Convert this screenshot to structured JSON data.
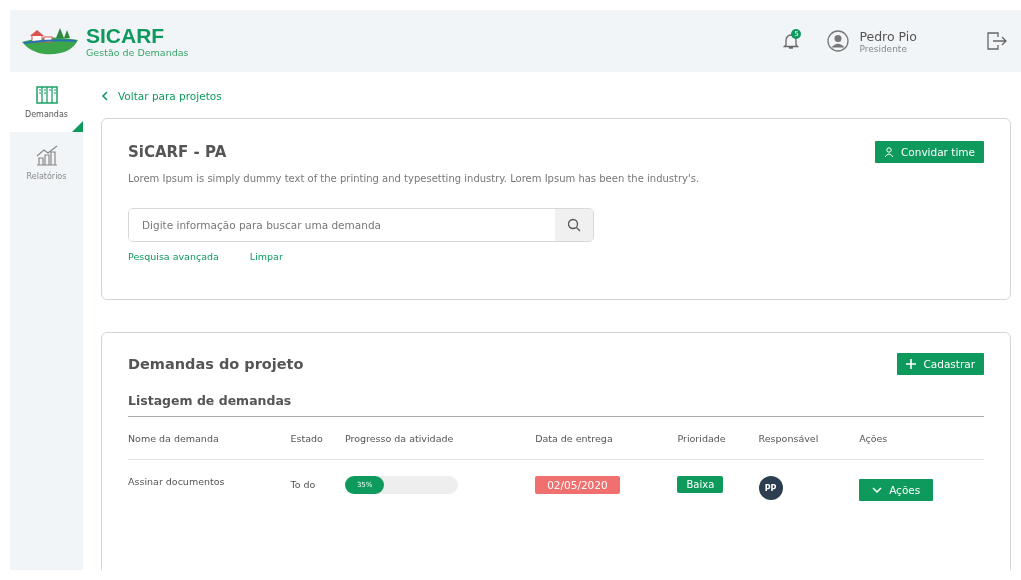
{
  "header": {
    "app_name": "SICARF",
    "subtitle": "Gestão de Demandas",
    "notification_count": "5",
    "user_name": "Pedro Pio",
    "user_role": "Presidente"
  },
  "sidebar": {
    "items": [
      {
        "label": "Demandas",
        "kind": "board",
        "selected": true
      },
      {
        "label": "Relatórios",
        "kind": "chart",
        "selected": false
      }
    ]
  },
  "back_link": "Voltar para projetos",
  "project": {
    "title": "SiCARF - PA",
    "description": "Lorem Ipsum is simply dummy text of the printing and typesetting industry. Lorem Ipsum has been the industry's.",
    "invite_button": "Convidar time",
    "search": {
      "placeholder": "Digite informação para buscar uma demanda"
    },
    "links": [
      "Pesquisa avançada",
      "Limpar"
    ]
  },
  "demands": {
    "title": "Demandas do projeto",
    "add_button": "Cadastrar",
    "subtitle": "Listagem de demandas",
    "columns": [
      "Nome da demanda",
      "Estado",
      "Progresso da atividade",
      "Data de entrega",
      "Prioridade",
      "Responsável",
      "Ações"
    ],
    "rows": [
      {
        "name": "Assinar documentos",
        "state": "To do",
        "level": 0.35,
        "progress_label": "35%",
        "due_date": "02/05/2020",
        "overdue": true,
        "priority": "Baixa",
        "assignee": "PP",
        "actions": "Ações"
      }
    ]
  }
}
